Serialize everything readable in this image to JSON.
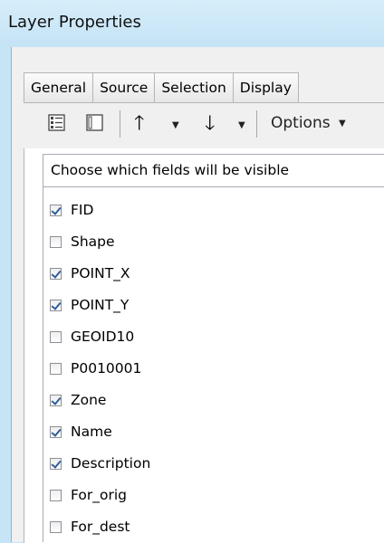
{
  "window": {
    "title": "Layer Properties"
  },
  "tabs": [
    "General",
    "Source",
    "Selection",
    "Display"
  ],
  "toolbar": {
    "options_label": "Options"
  },
  "fields_list": {
    "header": "Choose which fields will be visible",
    "items": [
      {
        "label": "FID",
        "checked": true
      },
      {
        "label": "Shape",
        "checked": false
      },
      {
        "label": "POINT_X",
        "checked": true
      },
      {
        "label": "POINT_Y",
        "checked": true
      },
      {
        "label": "GEOID10",
        "checked": false
      },
      {
        "label": "P0010001",
        "checked": false
      },
      {
        "label": "Zone",
        "checked": true
      },
      {
        "label": "Name",
        "checked": true
      },
      {
        "label": "Description",
        "checked": true
      },
      {
        "label": "For_orig",
        "checked": false
      },
      {
        "label": "For_dest",
        "checked": false
      }
    ]
  },
  "colors": {
    "title_bar": "#c7e6f7",
    "checkmark": "#2f5d9a"
  },
  "icons": [
    "table-view-icon",
    "list-view-icon",
    "move-up-icon",
    "move-down-icon",
    "chevron-down-icon"
  ]
}
